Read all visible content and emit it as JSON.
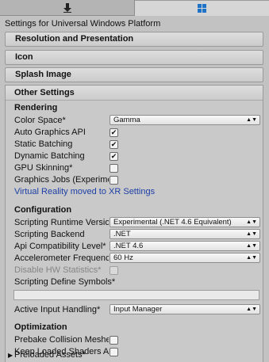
{
  "tabs": [
    {
      "icon": "download-arrow-icon",
      "active": false
    },
    {
      "icon": "windows-logo-icon",
      "active": true
    }
  ],
  "platform_title": "Settings for Universal Windows Platform",
  "sections": {
    "resolution": "Resolution and Presentation",
    "icon": "Icon",
    "splash": "Splash Image",
    "other": "Other Settings"
  },
  "rendering": {
    "heading": "Rendering",
    "color_space_label": "Color Space*",
    "color_space_value": "Gamma",
    "auto_graphics_api_label": "Auto Graphics API",
    "auto_graphics_api_checked": true,
    "static_batching_label": "Static Batching",
    "static_batching_checked": true,
    "dynamic_batching_label": "Dynamic Batching",
    "dynamic_batching_checked": true,
    "gpu_skinning_label": "GPU Skinning*",
    "gpu_skinning_checked": false,
    "graphics_jobs_label": "Graphics Jobs (Experimental)",
    "graphics_jobs_checked": false,
    "vr_link": "Virtual Reality moved to XR Settings"
  },
  "configuration": {
    "heading": "Configuration",
    "scripting_runtime_label": "Scripting Runtime Version",
    "scripting_runtime_value": "Experimental (.NET 4.6 Equivalent)",
    "scripting_backend_label": "Scripting Backend",
    "scripting_backend_value": ".NET",
    "api_compat_label": "Api Compatibility Level*",
    "api_compat_value": ".NET 4.6",
    "accelerometer_label": "Accelerometer Frequency",
    "accelerometer_value": "60 Hz",
    "disable_hw_stats_label": "Disable HW Statistics*",
    "disable_hw_stats_checked": false,
    "define_symbols_label": "Scripting Define Symbols*",
    "define_symbols_value": "",
    "active_input_label": "Active Input Handling*",
    "active_input_value": "Input Manager"
  },
  "optimization": {
    "heading": "Optimization",
    "prebake_label": "Prebake Collision Meshes*",
    "prebake_checked": false,
    "keep_shaders_label": "Keep Loaded Shaders Alive",
    "keep_shaders_checked": false,
    "preloaded_assets_label": "Preloaded Assets*"
  },
  "glyphs": {
    "check": "✔",
    "dropdown_arrow": "▲▼",
    "foldout": "▶"
  }
}
